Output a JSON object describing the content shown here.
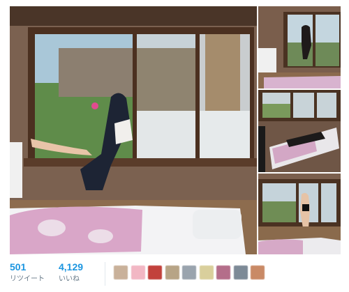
{
  "tweet": {
    "stats": {
      "retweets_count": "501",
      "retweets_label": "リツイート",
      "likes_count": "4,129",
      "likes_label": "いいね"
    },
    "likers": [
      {
        "icon": "avatar-1",
        "color": "#c9b19a"
      },
      {
        "icon": "avatar-2",
        "color": "#f2b7c4"
      },
      {
        "icon": "avatar-3",
        "color": "#c2413c"
      },
      {
        "icon": "avatar-4",
        "color": "#b7a486"
      },
      {
        "icon": "avatar-5",
        "color": "#9aa4ae"
      },
      {
        "icon": "avatar-6",
        "color": "#d9cf9c"
      },
      {
        "icon": "avatar-7",
        "color": "#b46e8a"
      },
      {
        "icon": "avatar-8",
        "color": "#7d8a97"
      },
      {
        "icon": "avatar-9",
        "color": "#c98a66"
      }
    ]
  },
  "colors": {
    "accent": "#1b95e0",
    "label": "#657786"
  }
}
